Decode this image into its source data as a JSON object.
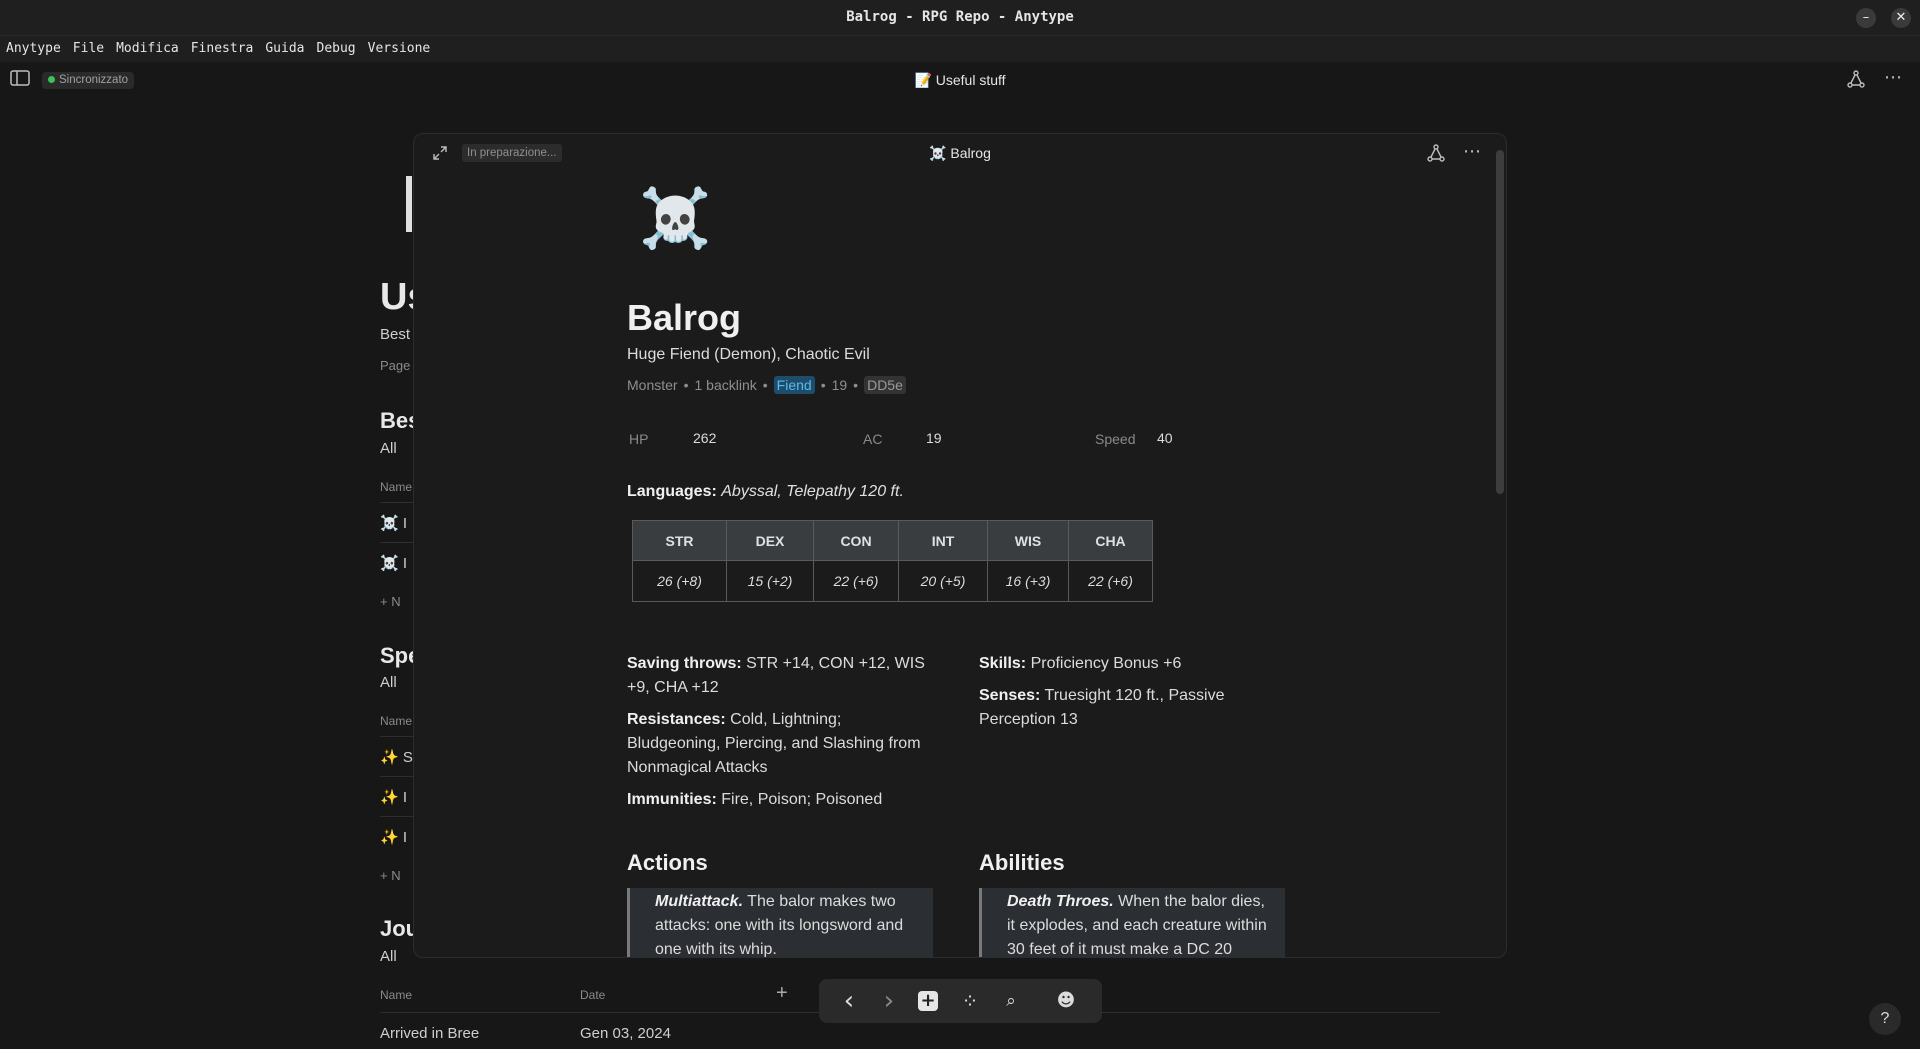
{
  "window": {
    "title": "Balrog - RPG Repo - Anytype",
    "minimize": "–",
    "close": "✕"
  },
  "menu": [
    "Anytype",
    "File",
    "Modifica",
    "Finestra",
    "Guida",
    "Debug",
    "Versione"
  ],
  "topbar": {
    "sync_status": "Sincronizzato",
    "page_title": "📝 Useful stuff"
  },
  "background_page": {
    "title_fragment": "Us",
    "subtitle_fragment": "Best",
    "muted_fragment": "Page",
    "sections": [
      {
        "heading": "Bes",
        "filter": "All",
        "name_col": "Name",
        "rows": [
          "☠️ I",
          "☠️ I"
        ],
        "new": "+ N"
      },
      {
        "heading": "Spe",
        "filter": "All",
        "name_col": "Name",
        "rows": [
          "✨ S",
          "✨ I",
          "✨ I"
        ],
        "new": "+ N"
      },
      {
        "heading": "Jou",
        "filter": "All",
        "name_col": "Name",
        "date_col": "Date",
        "rows": [
          {
            "name": "Arrived in Bree",
            "date": "Gen 03, 2024"
          }
        ]
      }
    ]
  },
  "modal": {
    "status_badge": "In preparazione...",
    "title": "☠️ Balrog",
    "icon": "☠️",
    "object_title": "Balrog",
    "description": "Huge Fiend (Demon), Chaotic Evil",
    "meta": {
      "type": "Monster",
      "backlinks": "1 backlink",
      "tag": "Fiend",
      "number": "19",
      "source": "DD5e"
    },
    "relations": [
      {
        "key": "HP",
        "value": "262"
      },
      {
        "key": "AC",
        "value": "19"
      },
      {
        "key": "Speed",
        "value": "40"
      }
    ],
    "languages_label": "Languages:",
    "languages_value": "Abyssal, Telepathy 120 ft.",
    "stats": {
      "headers": [
        "STR",
        "DEX",
        "CON",
        "INT",
        "WIS",
        "CHA"
      ],
      "values": [
        "26 (+8)",
        "15 (+2)",
        "22 (+6)",
        "20 (+5)",
        "16 (+3)",
        "22 (+6)"
      ]
    },
    "left_col": [
      {
        "label": "Saving throws:",
        "text": " STR +14, CON +12, WIS +9, CHA +12"
      },
      {
        "label": "Resistances:",
        "text": " Cold, Lightning; Bludgeoning, Piercing, and Slashing from Nonmagical Attacks"
      },
      {
        "label": "Immunities:",
        "text": " Fire, Poison; Poisoned"
      }
    ],
    "right_col": [
      {
        "label": "Skills:",
        "text": " Proficiency Bonus +6"
      },
      {
        "label": "Senses:",
        "text": " Truesight 120 ft., Passive Perception 13"
      }
    ],
    "actions_heading": "Actions",
    "abilities_heading": "Abilities",
    "action_callout": {
      "label": "Multiattack.",
      "text": " The balor makes two attacks: one with its longsword and one with its whip."
    },
    "ability_callout": {
      "label": "Death Throes.",
      "text": " When the balor dies, it explodes, and each creature within 30 feet of it must make a DC 20"
    }
  },
  "bottom_nav": {
    "back": "‹",
    "forward": "›",
    "add": "+",
    "graph": "⁘",
    "search": "⌕",
    "avatar": "☻"
  },
  "help": "?",
  "colors": {
    "accent_tag": "#5cb8f0",
    "sync_dot": "#3cc25a"
  }
}
